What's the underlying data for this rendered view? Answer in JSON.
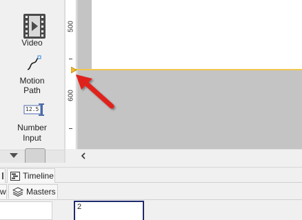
{
  "toolbox": {
    "items": [
      {
        "label": "Video",
        "icon": "video-icon"
      },
      {
        "label": "Motion\nPath",
        "line1": "Motion",
        "line2": "Path",
        "icon": "motion-path-icon"
      },
      {
        "label": "Number Input",
        "line1": "Number",
        "line2": "Input",
        "icon": "number-input-icon",
        "icon_text": "12.5"
      }
    ]
  },
  "ruler": {
    "labels": [
      "500",
      "600"
    ]
  },
  "bottom": {
    "tabs_row1": [
      {
        "label": "Timeline",
        "icon": "timeline-icon"
      }
    ],
    "tabs_row2": [
      {
        "label": "w",
        "partial": true
      },
      {
        "label": "Masters",
        "icon": "masters-icon"
      }
    ],
    "slide_number": "2"
  },
  "colors": {
    "canvas_gray": "#c4c4c4",
    "guide_line": "#f3c64e",
    "arrow_red": "#e0201b",
    "slide_border": "#1f2a6e"
  }
}
